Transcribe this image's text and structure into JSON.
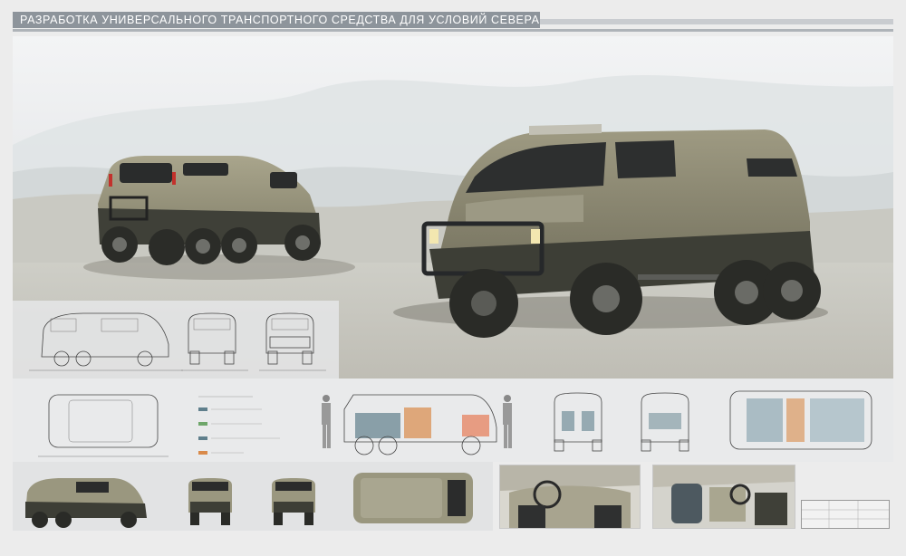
{
  "header": {
    "title": "РАЗРАБОТКА УНИВЕРСАЛЬНОГО ТРАНСПОРТНОГО СРЕДСТВА ДЛЯ УСЛОВИЙ СЕВЕРА"
  },
  "colors": {
    "title_band": "#8d949b",
    "body_olive": "#8f8b74",
    "lower_body": "#3d3e36",
    "seat_teal": "#5f7f8c",
    "seat_orange": "#d98a4a",
    "background": "#ececec"
  },
  "icons": [
    "vehicle-render",
    "vehicle-drawing",
    "human-figure",
    "interior-photo"
  ]
}
